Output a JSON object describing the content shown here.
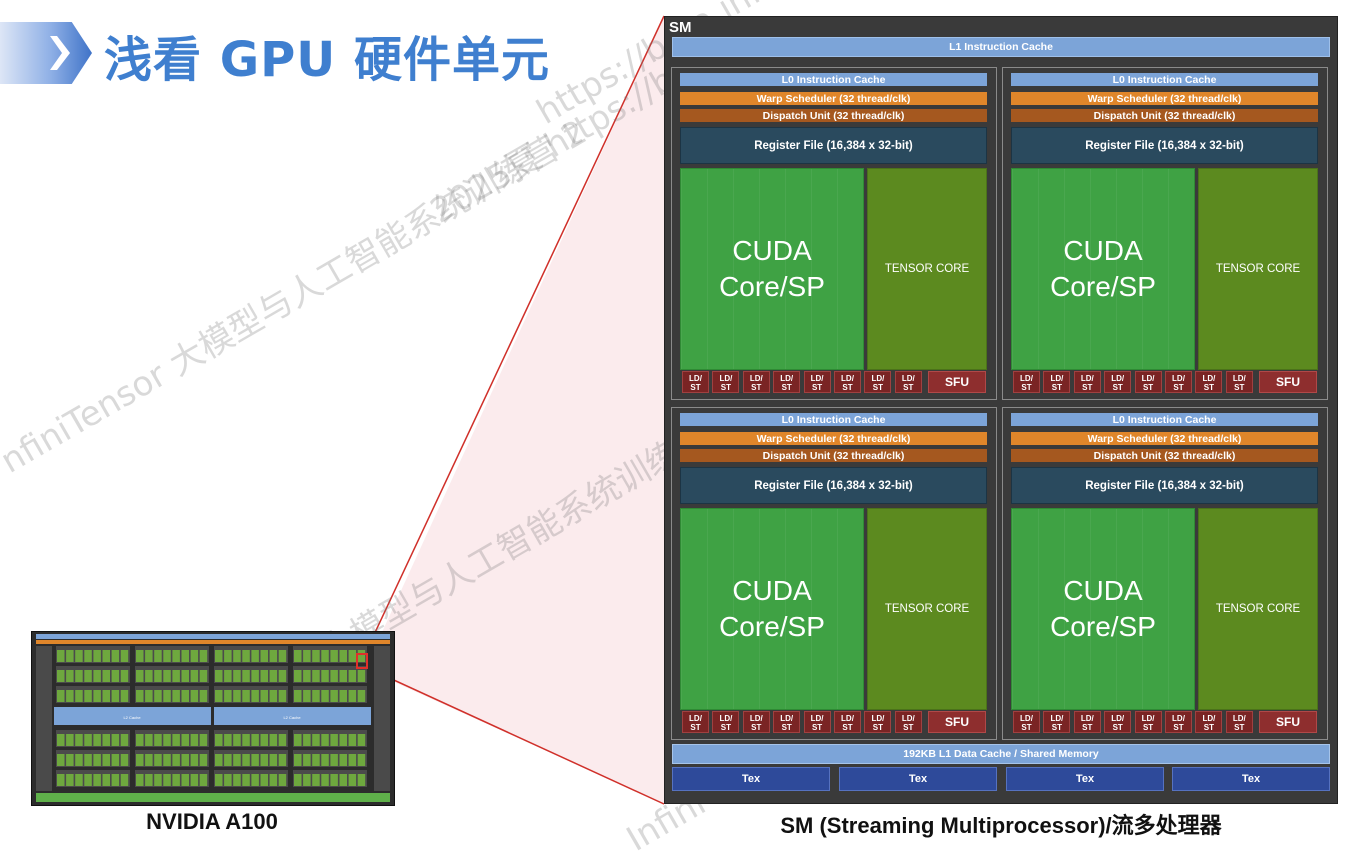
{
  "slide": {
    "title": "浅看 GPU 硬件单元",
    "watermarks": [
      "https://beta.infini",
      "2025夏 https://beta",
      "nfiniTensor 大模型与人工智能系统训练营 2",
      "大模型与人工智能系统训练营 2",
      "Infini"
    ]
  },
  "chip": {
    "caption": "NVIDIA A100",
    "center_label": "L2 Cache"
  },
  "sm": {
    "label": "SM",
    "l1_instruction_cache": "L1 Instruction Cache",
    "quadrants": [
      {
        "l0": "L0 Instruction Cache",
        "warp": "Warp Scheduler (32 thread/clk)",
        "dispatch": "Dispatch Unit (32 thread/clk)",
        "register": "Register File (16,384 x 32-bit)",
        "cuda_line1": "CUDA",
        "cuda_line2": "Core/SP",
        "tensor": "TENSOR CORE",
        "ldst": [
          "LD/",
          "ST"
        ],
        "sfu": "SFU"
      },
      {
        "l0": "L0 Instruction Cache",
        "warp": "Warp Scheduler (32 thread/clk)",
        "dispatch": "Dispatch Unit (32 thread/clk)",
        "register": "Register File (16,384 x 32-bit)",
        "cuda_line1": "CUDA",
        "cuda_line2": "Core/SP",
        "tensor": "TENSOR CORE",
        "ldst": [
          "LD/",
          "ST"
        ],
        "sfu": "SFU"
      },
      {
        "l0": "L0 Instruction Cache",
        "warp": "Warp Scheduler (32 thread/clk)",
        "dispatch": "Dispatch Unit (32 thread/clk)",
        "register": "Register File (16,384 x 32-bit)",
        "cuda_line1": "CUDA",
        "cuda_line2": "Core/SP",
        "tensor": "TENSOR CORE",
        "ldst": [
          "LD/",
          "ST"
        ],
        "sfu": "SFU"
      },
      {
        "l0": "L0 Instruction Cache",
        "warp": "Warp Scheduler (32 thread/clk)",
        "dispatch": "Dispatch Unit (32 thread/clk)",
        "register": "Register File (16,384 x 32-bit)",
        "cuda_line1": "CUDA",
        "cuda_line2": "Core/SP",
        "tensor": "TENSOR CORE",
        "ldst": [
          "LD/",
          "ST"
        ],
        "sfu": "SFU"
      }
    ],
    "l1_data_cache": "192KB L1 Data Cache / Shared Memory",
    "tex_units": [
      "Tex",
      "Tex",
      "Tex",
      "Tex"
    ],
    "caption": "SM (Streaming Multiprocessor)/流多处理器"
  },
  "colors": {
    "title_blue": "#3f7fcf",
    "cuda_green": "#3fa244",
    "tensor_green": "#5c8a1f",
    "warp_orange": "#e0862a",
    "dispatch_brown": "#a5581f",
    "register_teal": "#2a4a5e",
    "ldst_red": "#7a2424",
    "tex_blue": "#2e4a9a",
    "cache_blue": "#7ca4d8",
    "zoom_red": "#d0302a"
  }
}
